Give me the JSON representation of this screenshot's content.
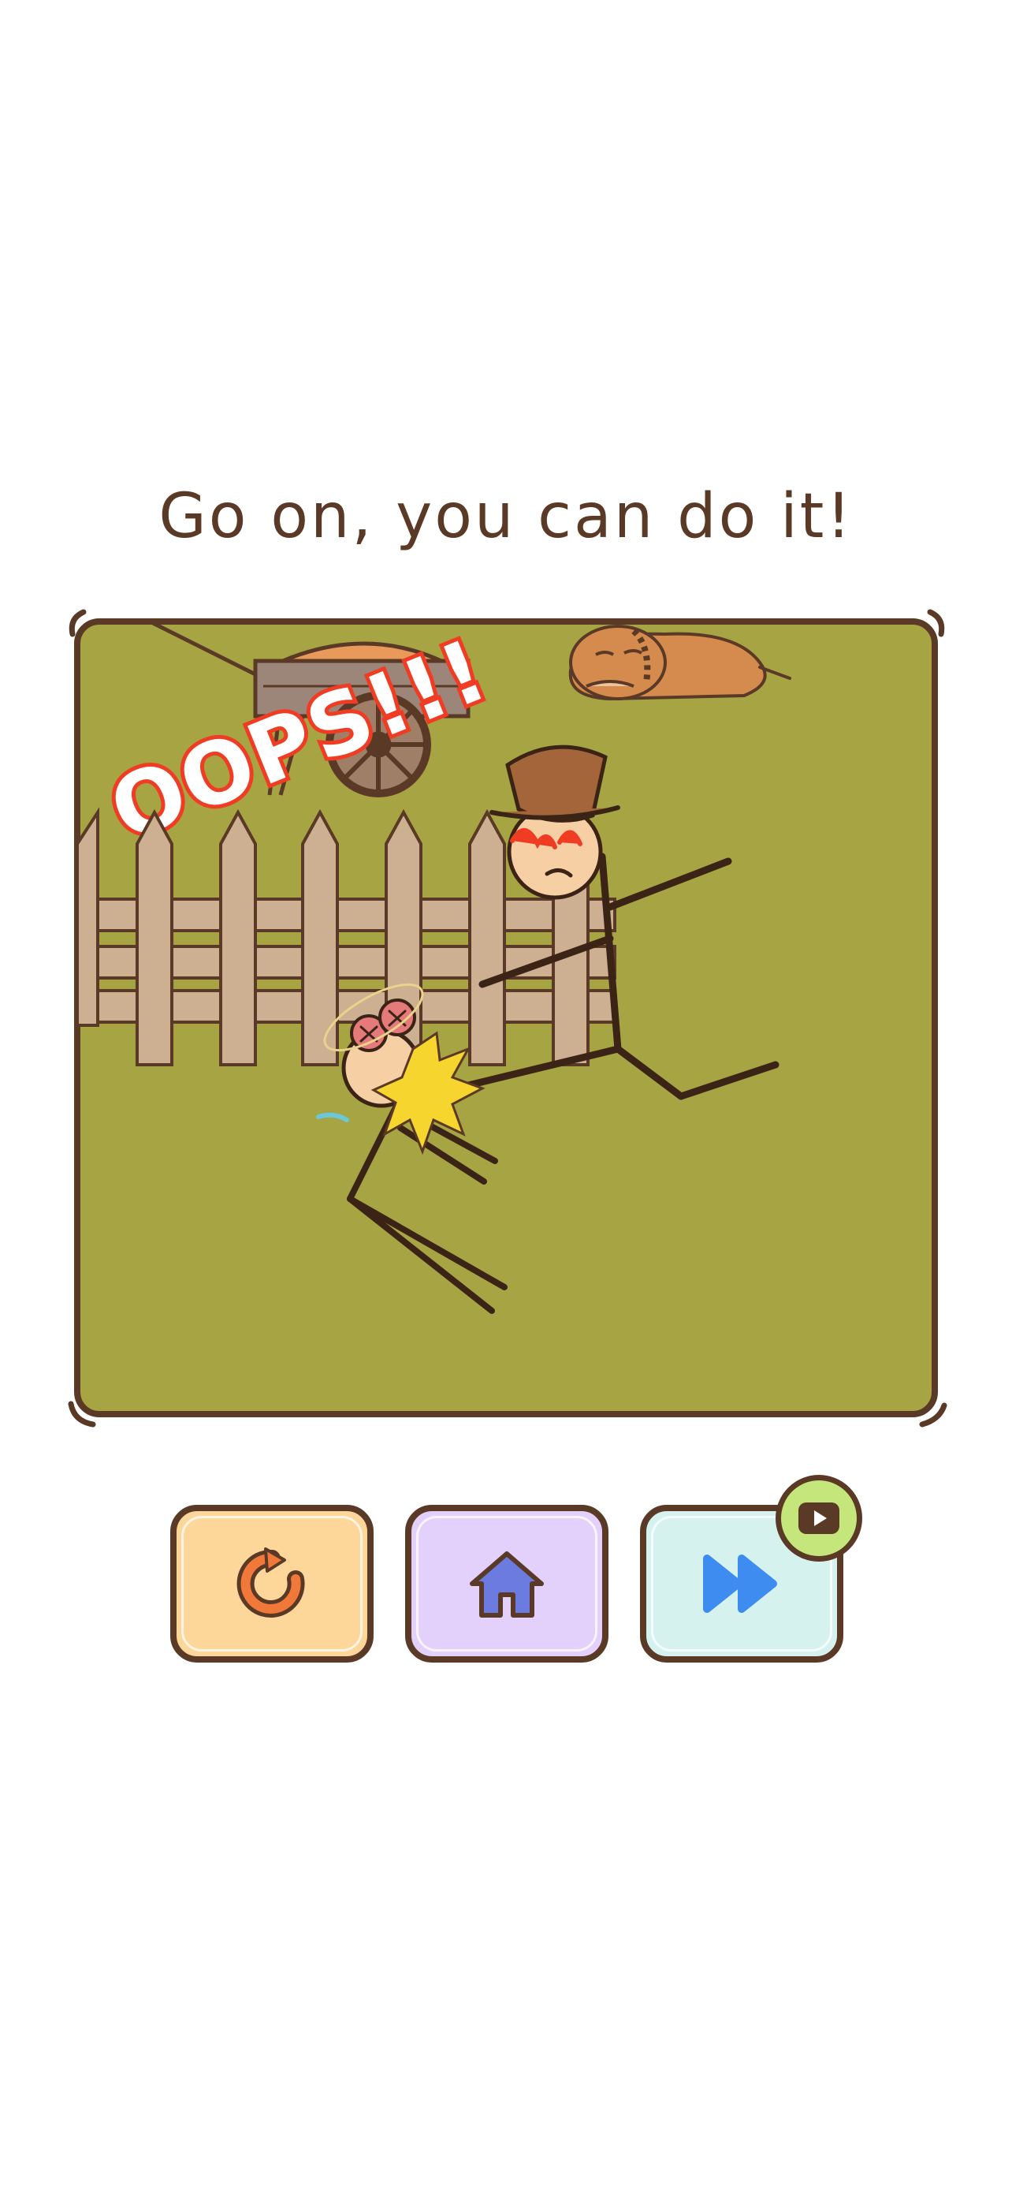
{
  "header": {
    "title": "Go on, you can do it!"
  },
  "scene": {
    "overlay_text": "OOPS!!!",
    "colors": {
      "grass": "#a7a444",
      "frame": "#5a3a26",
      "fence": "#cdb092",
      "oops": "#f13c24",
      "dog": "#d58b4d",
      "pot": "#a4653a"
    }
  },
  "buttons": {
    "retry": {
      "icon": "retry-icon",
      "color": "#fdd699"
    },
    "home": {
      "icon": "home-icon",
      "color": "#e3d0fb"
    },
    "skip": {
      "icon": "fast-forward-icon",
      "color": "#d6f2ef"
    },
    "video_badge": {
      "icon": "video-play-icon",
      "color": "#c5e67a"
    }
  }
}
